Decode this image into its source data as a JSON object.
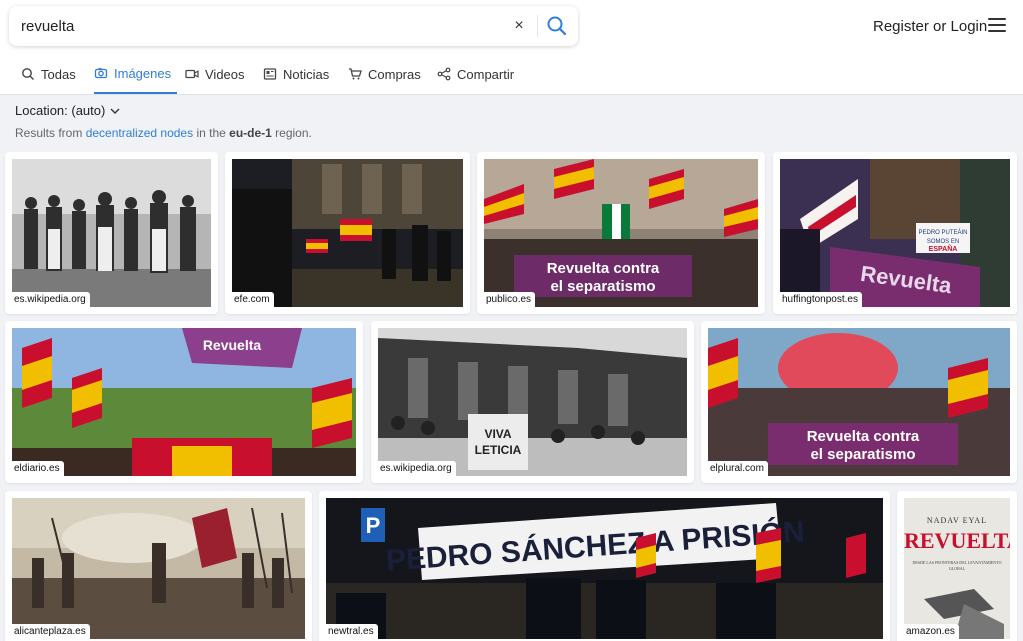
{
  "search": {
    "query": "revuelta",
    "clear_glyph": "×"
  },
  "header": {
    "auth_label": "Register or Login"
  },
  "tabs": [
    {
      "label": "Todas",
      "icon": "search-icon"
    },
    {
      "label": "Imágenes",
      "icon": "camera-icon",
      "active": true
    },
    {
      "label": "Videos",
      "icon": "video-icon"
    },
    {
      "label": "Noticias",
      "icon": "newspaper-icon"
    },
    {
      "label": "Compras",
      "icon": "cart-icon"
    },
    {
      "label": "Compartir",
      "icon": "share-icon"
    }
  ],
  "location": {
    "label": "Location: (auto)"
  },
  "results": {
    "prefix": "Results from ",
    "link_text": "decentralized nodes",
    "middle": " in the ",
    "region": "eu-de-1",
    "suffix": " region."
  },
  "images": [
    {
      "source": "es.wikipedia.org"
    },
    {
      "source": "efe.com"
    },
    {
      "source": "publico.es",
      "banner": "Revuelta contra el separatismo"
    },
    {
      "source": "huffingtonpost.es",
      "banner": "Revuelta",
      "sign": "PEDRO PUTEÁIN SOMOS EN ESPAÑA"
    },
    {
      "source": "eldiario.es",
      "banner": "Revuelta"
    },
    {
      "source": "es.wikipedia.org",
      "sign": "VIVA LETICIA"
    },
    {
      "source": "elplural.com",
      "banner": "Revuelta contra el separatismo"
    },
    {
      "source": "alicanteplaza.es"
    },
    {
      "source": "newtral.es",
      "banner": "PEDRO SÁNCHEZ A PRISIÓN"
    },
    {
      "source": "amazon.es",
      "author": "NADAV EYAL",
      "title": "REVUELTA",
      "subtitle": "DESDE LAS FRONTERAS DEL LEVANTAMIENTO GLOBAL"
    }
  ],
  "colors": {
    "accent": "#2f7fd6",
    "page_bg": "#f1f2f6",
    "banner_purple": "#7a2d6e",
    "flag_red": "#c8102e",
    "flag_yellow": "#f1bf00"
  }
}
